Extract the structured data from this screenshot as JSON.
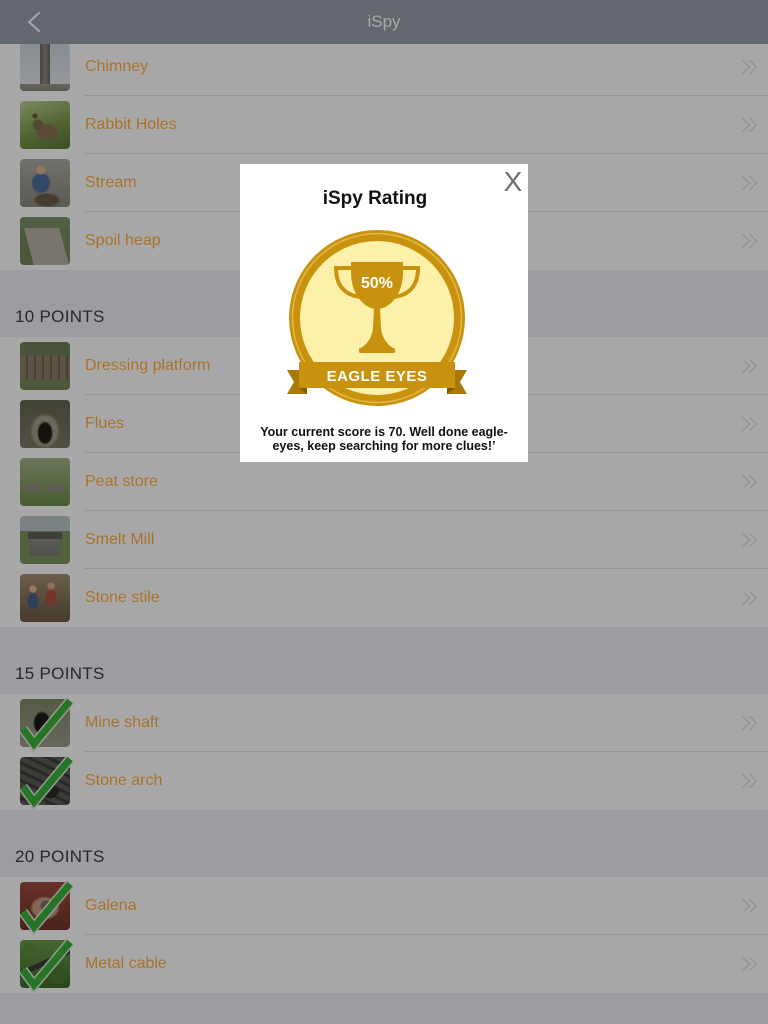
{
  "nav": {
    "title": "iSpy"
  },
  "icons": {
    "back": "chevron-left-icon",
    "disclosure": "double-chevron-right-icon",
    "found_mark": "checkmark-icon",
    "close": "close-icon",
    "badge": "trophy-icon"
  },
  "colors": {
    "accent": "#ffad42",
    "nav_bg": "#979ea8",
    "group_bg": "#efeff4",
    "header_text": "#3d3d3d",
    "chevron": "#d7d7db",
    "check_green": "#3bb03a",
    "badge_gold": "#c8920e",
    "badge_yellow": "#fdf0a8",
    "backdrop": "rgba(0,0,0,0.34)"
  },
  "sections": [
    {
      "items": [
        {
          "label": "Chimney",
          "found": false
        },
        {
          "label": "Rabbit Holes",
          "found": false
        },
        {
          "label": "Stream",
          "found": false
        },
        {
          "label": "Spoil heap",
          "found": false
        }
      ]
    },
    {
      "header": "10 POINTS",
      "items": [
        {
          "label": "Dressing platform",
          "found": false
        },
        {
          "label": "Flues",
          "found": false
        },
        {
          "label": "Peat store",
          "found": false
        },
        {
          "label": "Smelt Mill",
          "found": false
        },
        {
          "label": "Stone stile",
          "found": false
        }
      ]
    },
    {
      "header": "15 POINTS",
      "items": [
        {
          "label": "Mine shaft",
          "found": true
        },
        {
          "label": "Stone arch",
          "found": true
        }
      ]
    },
    {
      "header": "20 POINTS",
      "items": [
        {
          "label": "Galena",
          "found": true
        },
        {
          "label": "Metal cable",
          "found": true
        }
      ]
    }
  ],
  "modal": {
    "title": "iSpy Rating",
    "close_label": "X",
    "badge_percent": "50%",
    "badge_label": "EAGLE EYES",
    "message": "Your current score is 70. Well done eagle-eyes, keep searching for more clues!’"
  }
}
